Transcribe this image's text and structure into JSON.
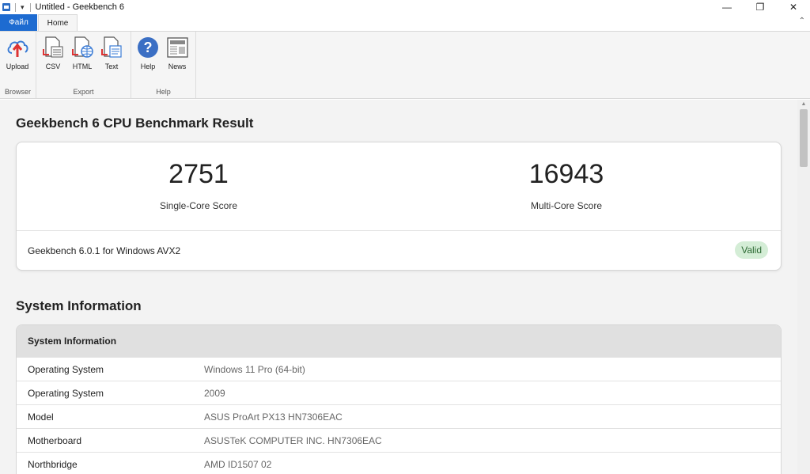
{
  "window": {
    "title": "Untitled - Geekbench 6"
  },
  "ribbon": {
    "tabs": [
      {
        "label": "Файл"
      },
      {
        "label": "Home"
      }
    ],
    "groups": [
      {
        "label": "Browser",
        "buttons": [
          {
            "label": "Upload",
            "icon": "upload-cloud-icon"
          }
        ]
      },
      {
        "label": "Export",
        "buttons": [
          {
            "label": "CSV",
            "icon": "csv-file-icon"
          },
          {
            "label": "HTML",
            "icon": "html-file-icon"
          },
          {
            "label": "Text",
            "icon": "text-file-icon"
          }
        ]
      },
      {
        "label": "Help",
        "buttons": [
          {
            "label": "Help",
            "icon": "help-icon"
          },
          {
            "label": "News",
            "icon": "news-icon"
          }
        ]
      }
    ]
  },
  "result": {
    "title": "Geekbench 6 CPU Benchmark Result",
    "single_core": {
      "value": "2751",
      "label": "Single-Core Score"
    },
    "multi_core": {
      "value": "16943",
      "label": "Multi-Core Score"
    },
    "version": "Geekbench 6.0.1 for Windows AVX2",
    "status": "Valid"
  },
  "system_info": {
    "section_title": "System Information",
    "table_header": "System Information",
    "rows": [
      {
        "key": "Operating System",
        "value": "Windows 11 Pro (64-bit)"
      },
      {
        "key": "Operating System",
        "value": "2009"
      },
      {
        "key": "Model",
        "value": "ASUS ProArt PX13 HN7306EAC"
      },
      {
        "key": "Motherboard",
        "value": "ASUSTeK COMPUTER INC. HN7306EAC"
      },
      {
        "key": "Northbridge",
        "value": "AMD ID1507 02"
      }
    ]
  },
  "colors": {
    "file_tab": "#1d6bd1",
    "valid_badge_bg": "#d4edd6",
    "valid_badge_text": "#2d6a34"
  }
}
